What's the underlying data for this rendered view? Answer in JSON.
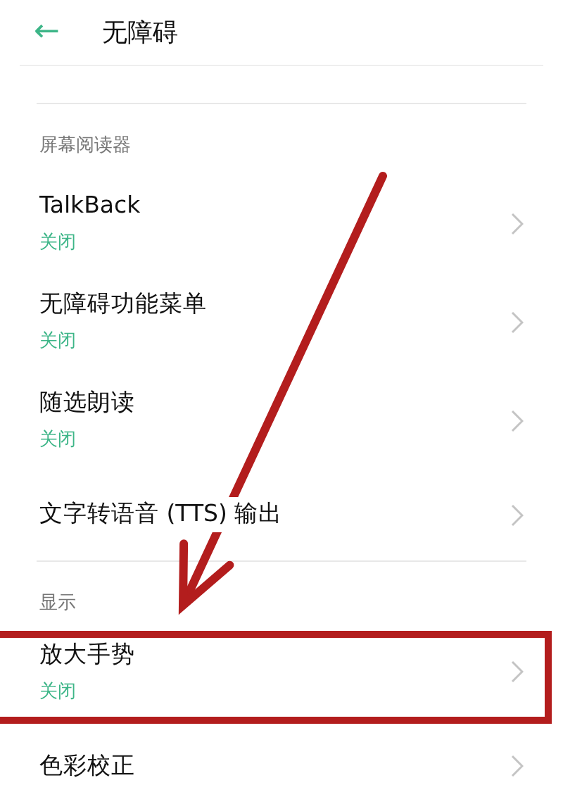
{
  "header": {
    "back": "←",
    "title": "无障碍"
  },
  "sections": [
    {
      "title": "屏幕阅读器",
      "items": [
        {
          "label": "TalkBack",
          "status": "关闭",
          "highlighted": false
        },
        {
          "label": "无障碍功能菜单",
          "status": "关闭",
          "highlighted": false
        },
        {
          "label": "随选朗读",
          "status": "关闭",
          "highlighted": false
        },
        {
          "label": "文字转语音 (TTS) 输出",
          "highlighted": false
        }
      ]
    },
    {
      "title": "显示",
      "items": [
        {
          "label": "放大手势",
          "status": "关闭",
          "highlighted": true
        },
        {
          "label": "色彩校正",
          "highlighted": false
        }
      ]
    }
  ]
}
